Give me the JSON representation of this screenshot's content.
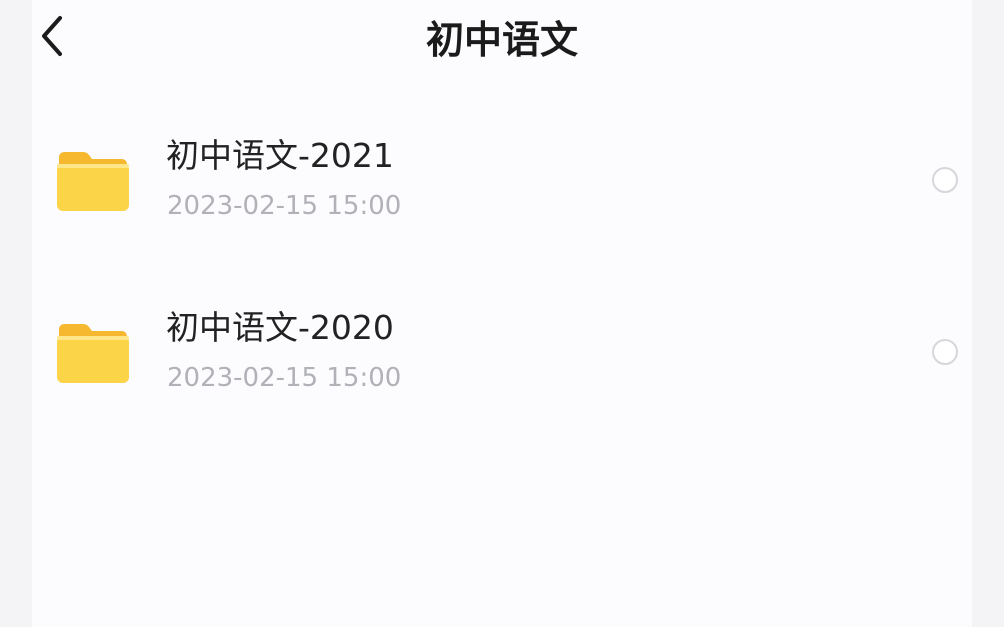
{
  "header": {
    "back_icon": "chevron-left-icon",
    "title": "初中语文"
  },
  "folders": [
    {
      "name": "初中语文-2021",
      "date": "2023-02-15 15:00",
      "icon": "folder-icon",
      "selected": false
    },
    {
      "name": "初中语文-2020",
      "date": "2023-02-15 15:00",
      "icon": "folder-icon",
      "selected": false
    }
  ],
  "colors": {
    "folder_body": "#fcd447",
    "folder_back": "#f5b82e",
    "title_text": "#1b1b1b",
    "date_text": "#b1b2b8",
    "radio_border": "#d6d6db"
  }
}
